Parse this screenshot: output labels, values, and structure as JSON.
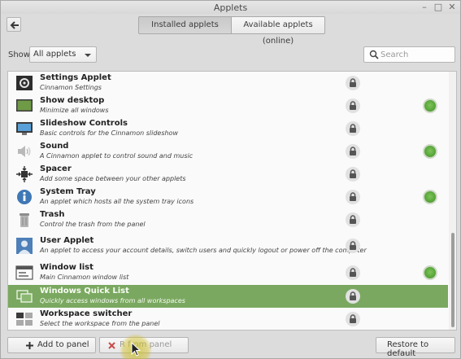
{
  "window": {
    "title": "Applets"
  },
  "tabs": {
    "installed": "Installed applets",
    "available": "Available applets (online)"
  },
  "filter": {
    "label": "Show",
    "selected": "All applets"
  },
  "search": {
    "placeholder": "Search",
    "value": ""
  },
  "applets": [
    {
      "name": "Settings Applet",
      "description": "Cinnamon Settings",
      "icon": "settings-applet-icon",
      "locked": true,
      "active": false,
      "selected": false
    },
    {
      "name": "Show desktop",
      "description": "Minimize all windows",
      "icon": "show-desktop-icon",
      "locked": true,
      "active": true,
      "selected": false
    },
    {
      "name": "Slideshow Controls",
      "description": "Basic controls for the Cinnamon slideshow",
      "icon": "slideshow-icon",
      "locked": true,
      "active": false,
      "selected": false
    },
    {
      "name": "Sound",
      "description": "A Cinnamon applet to control sound and music",
      "icon": "speaker-icon",
      "locked": true,
      "active": true,
      "selected": false
    },
    {
      "name": "Spacer",
      "description": "Add some space between your other applets",
      "icon": "spacer-icon",
      "locked": true,
      "active": false,
      "selected": false
    },
    {
      "name": "System Tray",
      "description": "An applet which hosts all the system tray icons",
      "icon": "info-icon",
      "locked": true,
      "active": true,
      "selected": false
    },
    {
      "name": "Trash",
      "description": "Control the trash from the panel",
      "icon": "trash-icon",
      "locked": true,
      "active": false,
      "selected": false
    },
    {
      "name": "User Applet",
      "description": "An applet to access your account details, switch users and quickly logout or power off the computer",
      "icon": "user-icon",
      "locked": true,
      "active": false,
      "selected": false
    },
    {
      "name": "Window list",
      "description": "Main Cinnamon window list",
      "icon": "window-list-icon",
      "locked": true,
      "active": true,
      "selected": false
    },
    {
      "name": "Windows Quick List",
      "description": "Quickly access windows from all workspaces",
      "icon": "windows-quick-list-icon",
      "locked": true,
      "active": false,
      "selected": true
    },
    {
      "name": "Workspace switcher",
      "description": "Select the workspace from the panel",
      "icon": "workspace-switcher-icon",
      "locked": true,
      "active": false,
      "selected": false
    }
  ],
  "buttons": {
    "add": "Add to panel",
    "remove": "R from panel",
    "restore": "Restore to default"
  },
  "colors": {
    "selected_row": "#7aa860",
    "active_dot": "#5aa93c"
  }
}
